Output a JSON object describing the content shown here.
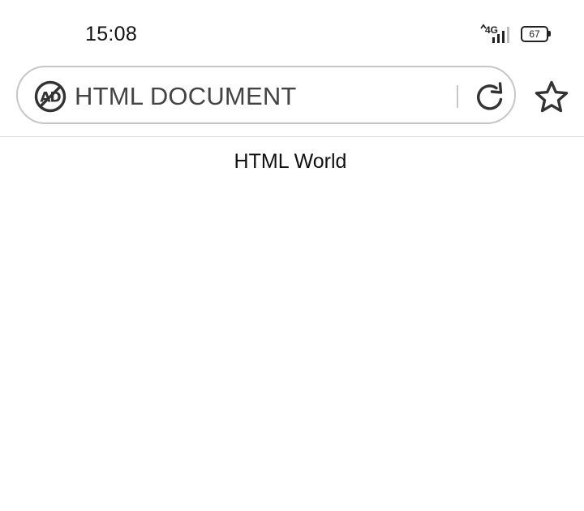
{
  "status_bar": {
    "time": "15:08",
    "network_label": "4G",
    "battery_level": "67",
    "icons": [
      "signal-icon",
      "battery-icon"
    ]
  },
  "address_bar": {
    "text": "HTML DOCUMENT",
    "icons": [
      "adblock-icon",
      "reload-icon",
      "star-icon"
    ]
  },
  "page": {
    "body_text": "HTML World"
  },
  "colors": {
    "pill_border": "#c6c6c6",
    "icon": "#333333",
    "text": "#111111"
  }
}
